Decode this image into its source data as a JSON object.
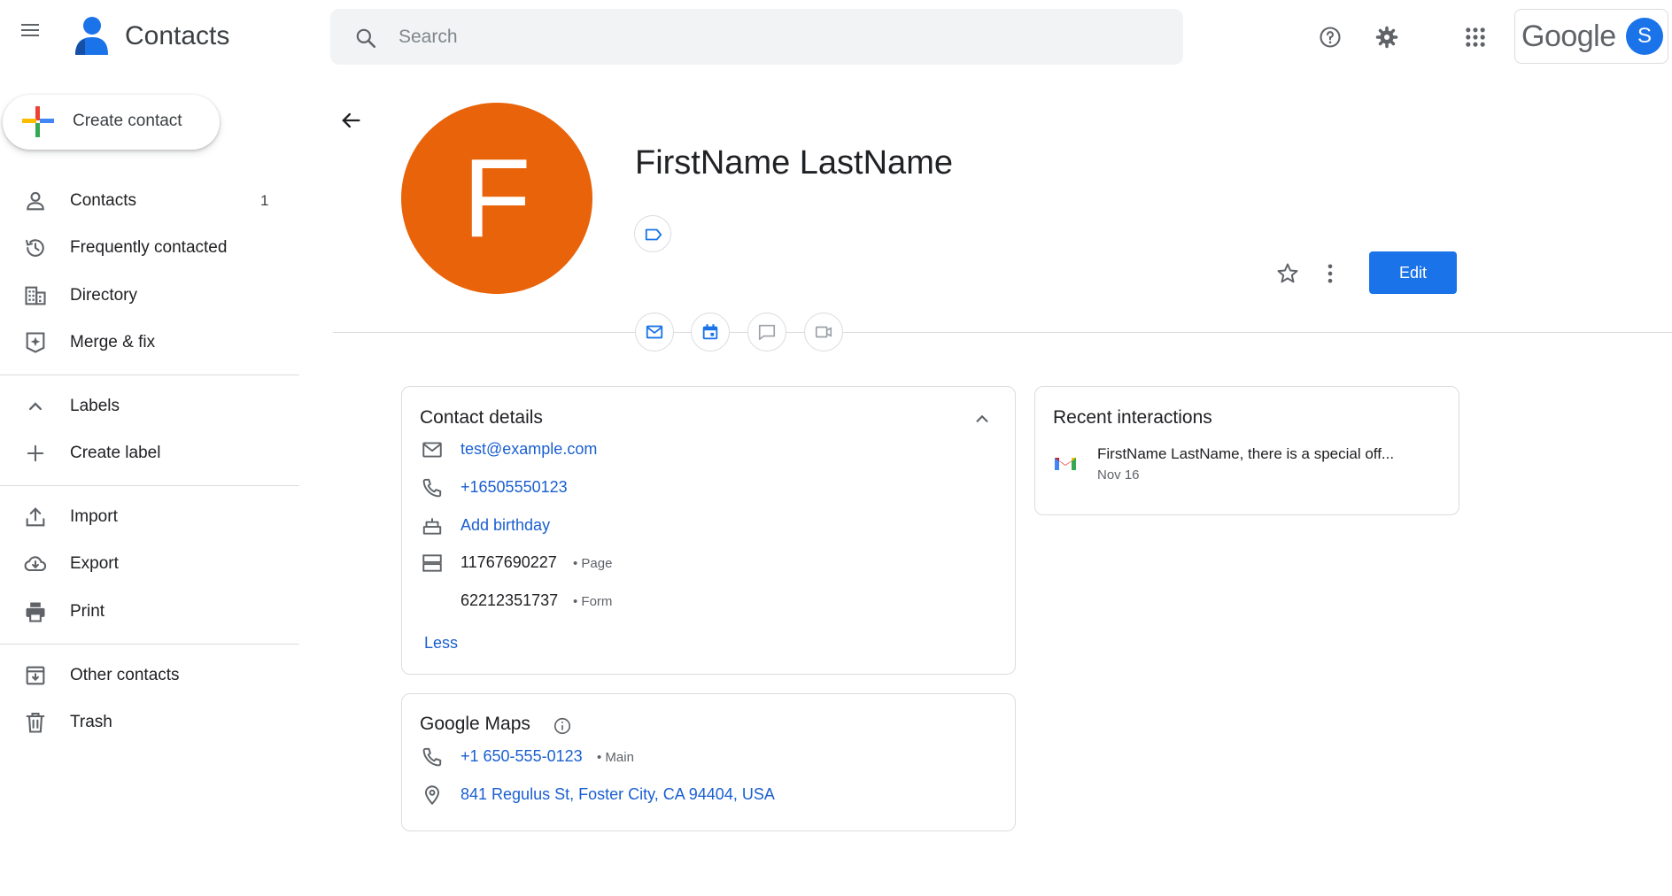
{
  "header": {
    "app_title": "Contacts",
    "search_placeholder": "Search",
    "search_value": "",
    "brand_word": "Google",
    "avatar_letter": "S"
  },
  "sidebar": {
    "create_label": "Create contact",
    "nav": [
      {
        "label": "Contacts",
        "count": "1",
        "icon": "person-icon"
      },
      {
        "label": "Frequently contacted",
        "icon": "history-icon"
      },
      {
        "label": "Directory",
        "icon": "building-icon"
      },
      {
        "label": "Merge & fix",
        "icon": "merge-fix-icon"
      }
    ],
    "labels_header": "Labels",
    "create_label_item": "Create label",
    "tools": [
      {
        "label": "Import",
        "icon": "upload-icon"
      },
      {
        "label": "Export",
        "icon": "cloud-download-icon"
      },
      {
        "label": "Print",
        "icon": "printer-icon"
      }
    ],
    "other": [
      {
        "label": "Other contacts",
        "icon": "archive-icon"
      },
      {
        "label": "Trash",
        "icon": "trash-icon"
      }
    ]
  },
  "contact": {
    "initial": "F",
    "name": "FirstName LastName",
    "edit_label": "Edit",
    "avatar_color": "#e8630a"
  },
  "details": {
    "title": "Contact details",
    "email": "test@example.com",
    "phone": "+16505550123",
    "birthday": "Add birthday",
    "ids": [
      {
        "value": "11767690227",
        "type": "• Page"
      },
      {
        "value": "62212351737",
        "type": "• Form"
      }
    ],
    "less": "Less"
  },
  "maps": {
    "title": "Google Maps",
    "phone": "+1 650-555-0123",
    "phone_type": "• Main",
    "address": "841 Regulus St, Foster City, CA 94404, USA"
  },
  "recent": {
    "title": "Recent interactions",
    "items": [
      {
        "text": "FirstName LastName, there is a special off...",
        "date": "Nov 16"
      }
    ]
  },
  "colors": {
    "accent": "#1a73e8",
    "link": "#1a5fd0"
  }
}
